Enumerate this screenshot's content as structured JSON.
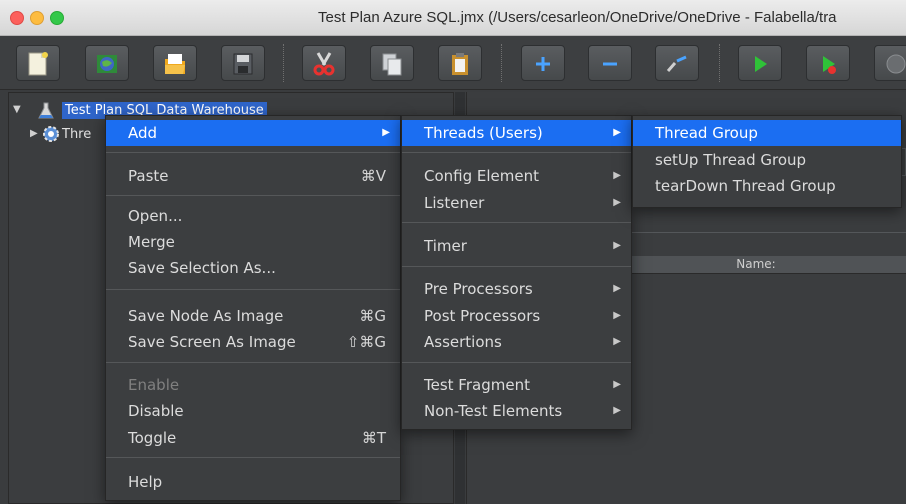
{
  "window": {
    "title": "Test Plan Azure SQL.jmx (/Users/cesarleon/OneDrive/OneDrive - Falabella/tra"
  },
  "toolbar": {
    "buttons": [
      "new-icon",
      "templates-icon",
      "open-icon",
      "save-icon",
      "cut-icon",
      "copy-icon",
      "paste-icon",
      "expand-icon",
      "collapse-icon",
      "toggle-icon",
      "start-icon",
      "start-no-pause-icon",
      "stop-icon"
    ]
  },
  "tree": {
    "root_label": "Test Plan SQL Data Warehouse",
    "child_label": "Thre"
  },
  "right_panel": {
    "name_header": "Name:"
  },
  "context_menu": {
    "items": [
      {
        "label": "Add",
        "shortcut": "",
        "submenu": true,
        "highlighted": true
      },
      {
        "label": "Paste",
        "shortcut": "⌘V"
      },
      {
        "label": "Open...",
        "shortcut": ""
      },
      {
        "label": "Merge",
        "shortcut": ""
      },
      {
        "label": "Save Selection As...",
        "shortcut": ""
      },
      {
        "label": "Save Node As Image",
        "shortcut": "⌘G"
      },
      {
        "label": "Save Screen As Image",
        "shortcut": "⇧⌘G"
      },
      {
        "label": "Enable",
        "shortcut": "",
        "disabled": true
      },
      {
        "label": "Disable",
        "shortcut": ""
      },
      {
        "label": "Toggle",
        "shortcut": "⌘T"
      },
      {
        "label": "Help",
        "shortcut": ""
      }
    ]
  },
  "add_submenu": {
    "items": [
      {
        "label": "Threads (Users)",
        "highlighted": true
      },
      {
        "label": "Config Element"
      },
      {
        "label": "Listener"
      },
      {
        "label": "Timer"
      },
      {
        "label": "Pre Processors"
      },
      {
        "label": "Post Processors"
      },
      {
        "label": "Assertions"
      },
      {
        "label": "Test Fragment"
      },
      {
        "label": "Non-Test Elements"
      }
    ]
  },
  "threads_submenu": {
    "items": [
      {
        "label": "Thread Group",
        "highlighted": true
      },
      {
        "label": "setUp Thread Group"
      },
      {
        "label": "tearDown Thread Group"
      }
    ]
  },
  "colors": {
    "highlight": "#1b6ef2",
    "tree_selection": "#2f65ca",
    "menu_bg": "#3c3e40"
  }
}
